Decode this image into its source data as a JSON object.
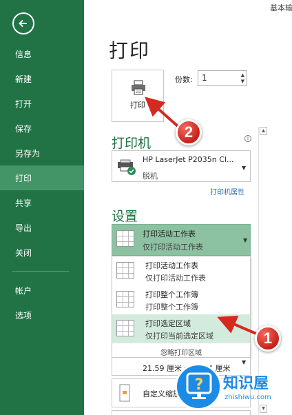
{
  "top_clipped_text": "基本输",
  "sidebar": {
    "items": [
      {
        "label": "信息"
      },
      {
        "label": "新建"
      },
      {
        "label": "打开"
      },
      {
        "label": "保存"
      },
      {
        "label": "另存为"
      },
      {
        "label": "打印"
      },
      {
        "label": "共享"
      },
      {
        "label": "导出"
      },
      {
        "label": "关闭"
      },
      {
        "label": "帐户"
      },
      {
        "label": "选项"
      }
    ],
    "active_index": 5
  },
  "main": {
    "title": "打印",
    "print_button_label": "打印",
    "copies_label": "份数:",
    "copies_value": "1",
    "printer_section_title": "打印机",
    "printer_name": "HP LaserJet P2035n Cl...",
    "printer_status": "脱机",
    "printer_properties_link": "打印机属性",
    "settings_section_title": "设置",
    "selected_option": {
      "main": "打印活动工作表",
      "sub": "仅打印活动工作表"
    },
    "dropdown_options": [
      {
        "main": "打印活动工作表",
        "sub": "仅打印活动工作表"
      },
      {
        "main": "打印整个工作簿",
        "sub": "打印整个工作簿"
      },
      {
        "main": "打印选定区域",
        "sub": "仅打印当前选定区域"
      }
    ],
    "dropdown_highlight_index": 2,
    "ignore_print_area": "忽略打印区域",
    "paper_size": "21.59 厘米 x 27.94 厘米",
    "custom_scaling": "自定义缩放"
  },
  "annotations": {
    "badge_1": "1",
    "badge_2": "2"
  },
  "watermark": {
    "title": "知识屋",
    "sub": "zhishiwu.com"
  },
  "colors": {
    "sidebar_bg": "#217346",
    "sidebar_active": "#439467",
    "accent_green": "#217346",
    "selected_box": "#8cc2a2",
    "highlight": "#d3ebdd",
    "badge_red": "#d42a22",
    "watermark_blue": "#1c8be6"
  }
}
